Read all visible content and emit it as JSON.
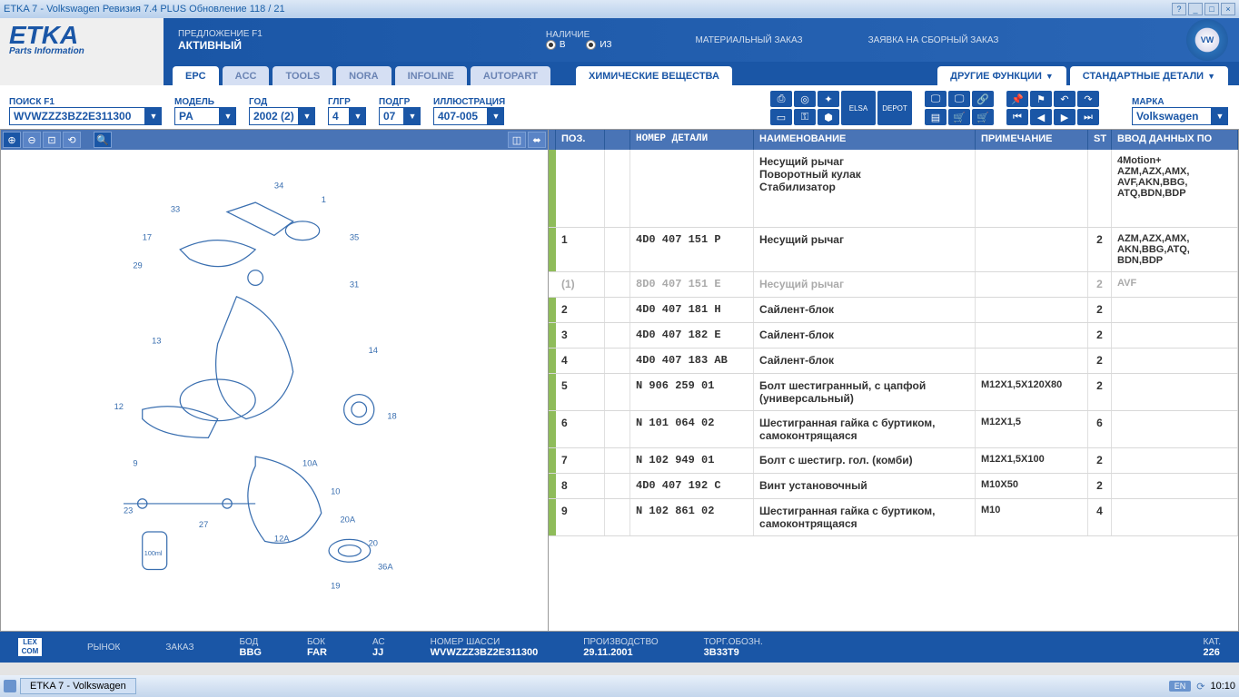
{
  "title": "ETKA 7 - Volkswagen Ревизия 7.4 PLUS Обновление 118 / 21",
  "logo": {
    "main": "ETKA",
    "sub": "Parts Information"
  },
  "header": {
    "offer_lbl": "ПРЕДЛОЖЕНИЕ F1",
    "offer_val": "АКТИВНЫЙ",
    "stock_lbl": "НАЛИЧИЕ",
    "radio_w": "В",
    "radio_iw": "ИЗ",
    "order_lbl": "МАТЕРИАЛЬНЫЙ ЗАКАЗ",
    "assembly_lbl": "ЗАЯВКА НА СБОРНЫЙ ЗАКАЗ"
  },
  "tabs": {
    "main": [
      "EPC",
      "ACC",
      "TOOLS",
      "NORA",
      "INFOLINE",
      "AUTOPART"
    ],
    "chem": "ХИМИЧЕСКИЕ ВЕЩЕСТВА",
    "func": "ДРУГИЕ ФУНКЦИИ",
    "std": "СТАНДАРТНЫЕ ДЕТАЛИ"
  },
  "filters": {
    "search_lbl": "ПОИСК F1",
    "search_val": "WVWZZZ3BZ2E311300",
    "model_lbl": "МОДЕЛЬ",
    "model_val": "PA",
    "year_lbl": "ГОД",
    "year_val": "2002 (2)",
    "mg_lbl": "ГЛГР",
    "mg_val": "4",
    "sg_lbl": "ПОДГР",
    "sg_val": "07",
    "ill_lbl": "ИЛЛЮСТРАЦИЯ",
    "ill_val": "407-005",
    "marka_lbl": "МАРКА",
    "marka_val": "Volkswagen"
  },
  "grid_headers": {
    "pos": "ПОЗ.",
    "part": "НОМЕР ДЕТАЛИ",
    "name": "НАИМЕНОВАНИЕ",
    "note": "ПРИМЕЧАНИЕ",
    "st": "ST",
    "data": "ВВОД ДАННЫХ ПО"
  },
  "header_row": {
    "name": "Несущий рычаг\nПоворотный кулак\nСтабилизатор",
    "data": "4Motion+\nAZM,AZX,AMX,\nAVF,AKN,BBG,\nATQ,BDN,BDP"
  },
  "rows": [
    {
      "pos": "1",
      "part": "4D0 407 151 P",
      "name": "Несущий рычаг",
      "note": "",
      "st": "2",
      "data": "AZM,AZX,AMX,\nAKN,BBG,ATQ,\nBDN,BDP",
      "green": true
    },
    {
      "pos": "(1)",
      "part": "8D0 407 151 E",
      "name": "Несущий рычаг",
      "note": "",
      "st": "2",
      "data": "AVF",
      "dim": true
    },
    {
      "pos": "2",
      "part": "4D0 407 181 H",
      "name": "Сайлент-блок",
      "note": "",
      "st": "2",
      "data": "",
      "green": true
    },
    {
      "pos": "3",
      "part": "4D0 407 182 E",
      "name": "Сайлент-блок",
      "note": "",
      "st": "2",
      "data": "",
      "green": true
    },
    {
      "pos": "4",
      "part": "4D0 407 183 AB",
      "name": "Сайлент-блок",
      "note": "",
      "st": "2",
      "data": "",
      "green": true
    },
    {
      "pos": "5",
      "part": "N  906 259 01",
      "name": "Болт шестигранный, с цапфой (универсальный)",
      "note": "M12X1,5X120X80",
      "st": "2",
      "data": "",
      "green": true
    },
    {
      "pos": "6",
      "part": "N  101 064 02",
      "name": "Шестигранная гайка с буртиком, самоконтрящаяся",
      "note": "M12X1,5",
      "st": "6",
      "data": "",
      "green": true
    },
    {
      "pos": "7",
      "part": "N  102 949 01",
      "name": "Болт с шестигр. гол. (комби)",
      "note": "M12X1,5X100",
      "st": "2",
      "data": "",
      "green": true
    },
    {
      "pos": "8",
      "part": "4D0 407 192 C",
      "name": "Винт установочный",
      "note": "M10X50",
      "st": "2",
      "data": "",
      "green": true
    },
    {
      "pos": "9",
      "part": "N  102 861 02",
      "name": "Шестигранная гайка с буртиком, самоконтрящаяся",
      "note": "M10",
      "st": "4",
      "data": "",
      "green": true
    }
  ],
  "status": {
    "market_lbl": "РЫНОК",
    "order_lbl": "ЗАКАЗ",
    "bod_lbl": "БОД",
    "bod_val": "BBG",
    "bok_lbl": "БОК",
    "bok_val": "FAR",
    "ac_lbl": "АС",
    "ac_val": "JJ",
    "vin_lbl": "НОМЕР ШАССИ",
    "vin_val": "WVWZZZ3BZ2E311300",
    "prod_lbl": "ПРОИЗВОДСТВО",
    "prod_val": "29.11.2001",
    "trade_lbl": "ТОРГ.ОБОЗН.",
    "trade_val": "3B33T9",
    "cat_lbl": "КАТ.",
    "cat_val": "226"
  },
  "taskbar": {
    "item": "ETKA 7 - Volkswagen",
    "lang": "EN",
    "time": "10:10"
  }
}
